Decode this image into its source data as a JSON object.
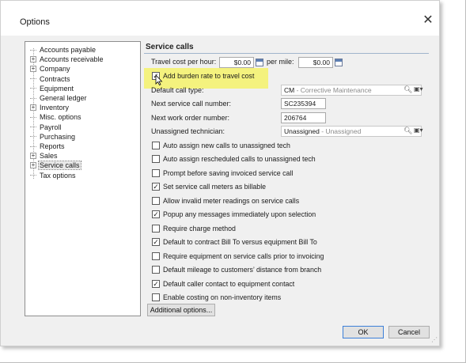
{
  "window": {
    "title": "Options",
    "close_glyph": "✕"
  },
  "tree": {
    "items": [
      {
        "label": "Accounts payable",
        "expandable": false
      },
      {
        "label": "Accounts receivable",
        "expandable": true
      },
      {
        "label": "Company",
        "expandable": true
      },
      {
        "label": "Contracts",
        "expandable": false
      },
      {
        "label": "Equipment",
        "expandable": false
      },
      {
        "label": "General ledger",
        "expandable": false
      },
      {
        "label": "Inventory",
        "expandable": true
      },
      {
        "label": "Misc. options",
        "expandable": false
      },
      {
        "label": "Payroll",
        "expandable": false
      },
      {
        "label": "Purchasing",
        "expandable": false
      },
      {
        "label": "Reports",
        "expandable": false
      },
      {
        "label": "Sales",
        "expandable": true
      },
      {
        "label": "Service calls",
        "expandable": true,
        "selected": true
      },
      {
        "label": "Tax options",
        "expandable": false
      }
    ]
  },
  "panel": {
    "title": "Service calls",
    "travel_cost_per_hour_label": "Travel cost per hour:",
    "travel_cost_per_hour_value": "$0.00",
    "per_mile_label": "per mile:",
    "per_mile_value": "$0.00",
    "burden_label": "Add burden rate to travel cost",
    "burden_checked": true,
    "default_call_type_label": "Default call type:",
    "default_call_type_code": "CM",
    "default_call_type_desc": " - Corrective Maintenance",
    "next_service_call_label": "Next service call number:",
    "next_service_call_value": "SC235394",
    "next_work_order_label": "Next work order number:",
    "next_work_order_value": "206764",
    "unassigned_tech_label": "Unassigned technician:",
    "unassigned_tech_code": "Unassigned",
    "unassigned_tech_desc": " - Unassigned",
    "checkboxes": [
      {
        "label": "Auto assign new calls to unassigned tech",
        "checked": false
      },
      {
        "label": "Auto assign rescheduled calls to unassigned tech",
        "checked": false
      },
      {
        "label": "Prompt before saving invoiced service call",
        "checked": false
      },
      {
        "label": "Set service call meters as billable",
        "checked": true
      },
      {
        "label": "Allow invalid meter readings on service calls",
        "checked": false
      },
      {
        "label": "Popup any messages immediately upon selection",
        "checked": true
      },
      {
        "label": "Require charge method",
        "checked": false
      },
      {
        "label": "Default to contract Bill To versus equipment Bill To",
        "checked": true
      },
      {
        "label": "Require equipment on service calls prior to invoicing",
        "checked": false
      },
      {
        "label": "Default mileage to customers’ distance from branch",
        "checked": false
      },
      {
        "label": "Default caller contact to equipment contact",
        "checked": true
      },
      {
        "label": "Enable costing on non-inventory items",
        "checked": false
      }
    ],
    "additional_options_label": "Additional options..."
  },
  "buttons": {
    "ok": "OK",
    "cancel": "Cancel"
  },
  "colors": {
    "highlight": "#f4f26a",
    "accent": "#3c7fd8",
    "rule": "#9fb4cc"
  }
}
